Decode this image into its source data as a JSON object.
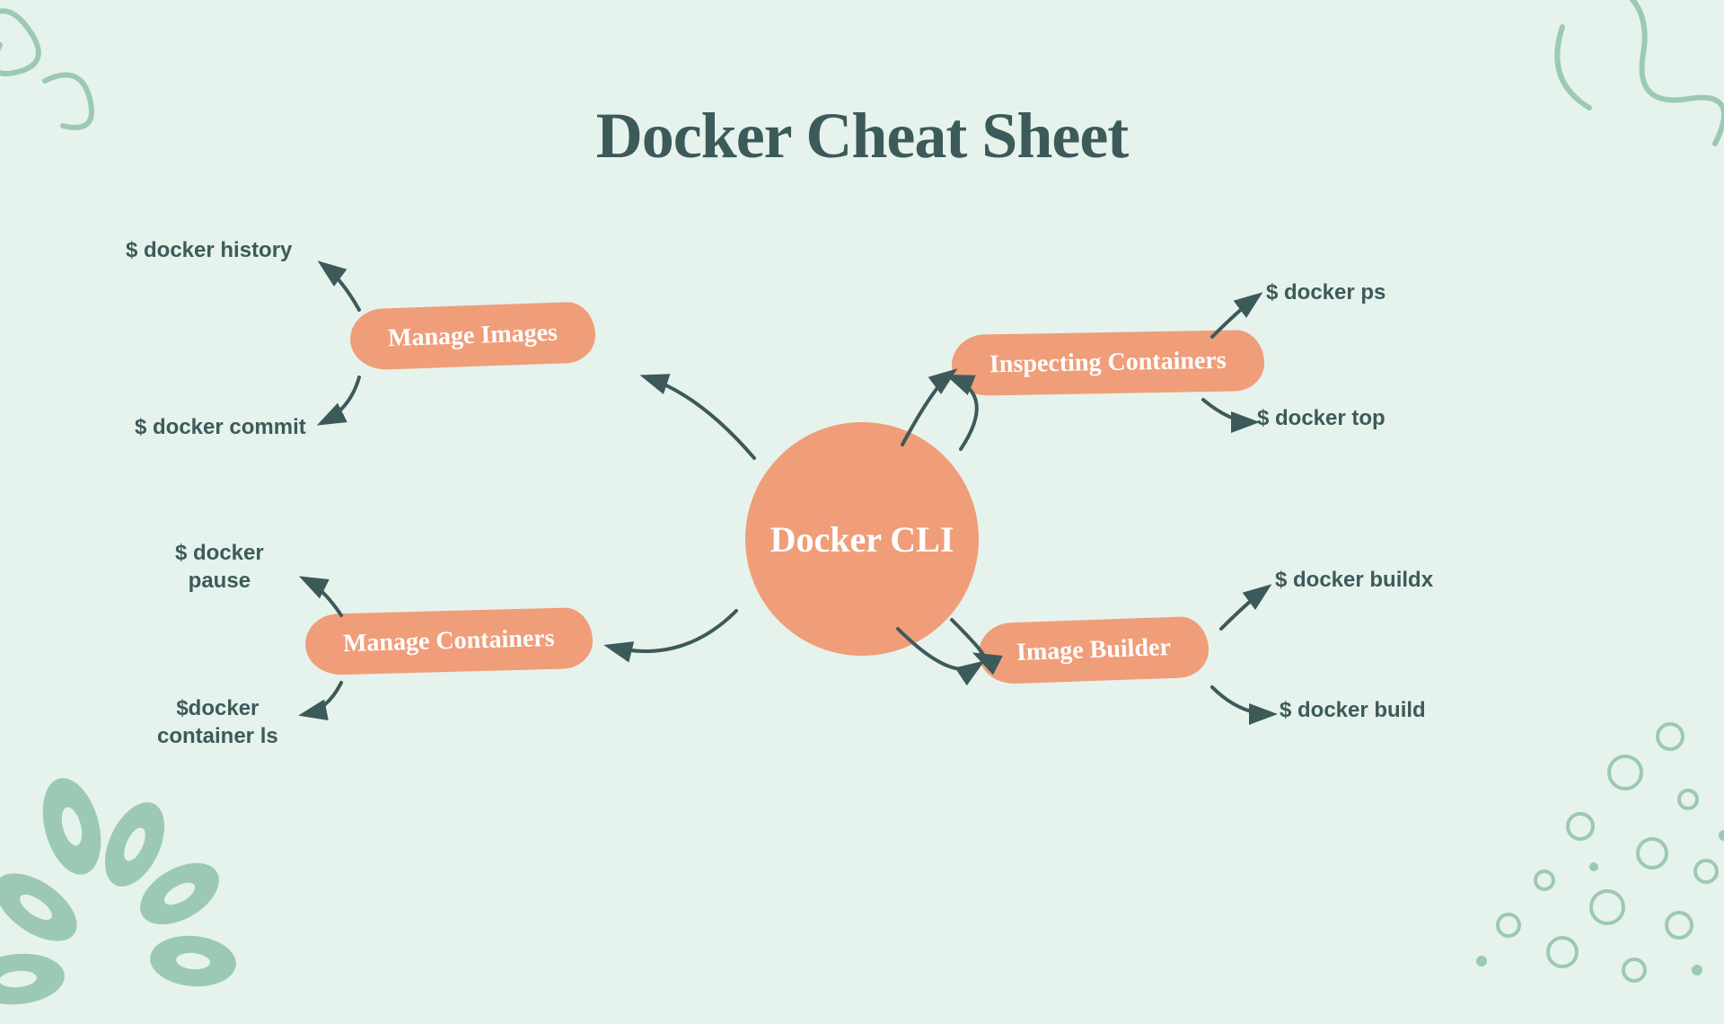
{
  "title": "Docker Cheat Sheet",
  "center": "Docker CLI",
  "branches": {
    "manage_images": {
      "label": "Manage Images",
      "cmds": {
        "history": "$ docker  history",
        "commit": "$ docker commit"
      }
    },
    "inspecting": {
      "label": "Inspecting Containers",
      "cmds": {
        "ps": "$ docker ps",
        "top": "$ docker top"
      }
    },
    "manage_containers": {
      "label": "Manage Containers",
      "cmds": {
        "pause": "$ docker\npause",
        "ls": "$docker\ncontainer ls"
      }
    },
    "image_builder": {
      "label": "Image Builder",
      "cmds": {
        "buildx": "$ docker buildx",
        "build": "$ docker build"
      }
    }
  }
}
